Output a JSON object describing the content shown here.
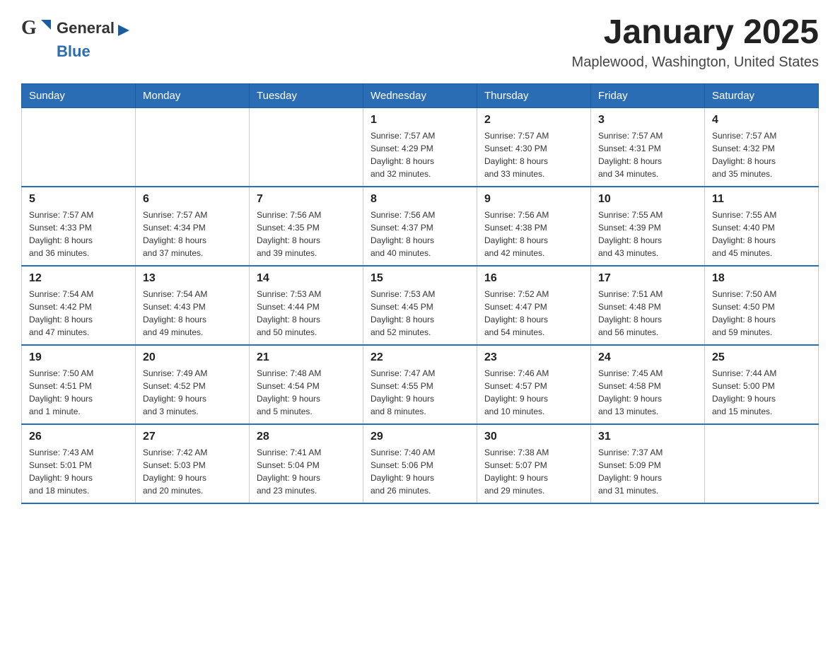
{
  "header": {
    "logo_general": "General",
    "logo_blue": "Blue",
    "title": "January 2025",
    "location": "Maplewood, Washington, United States"
  },
  "days_of_week": [
    "Sunday",
    "Monday",
    "Tuesday",
    "Wednesday",
    "Thursday",
    "Friday",
    "Saturday"
  ],
  "weeks": [
    {
      "days": [
        {
          "number": "",
          "info": ""
        },
        {
          "number": "",
          "info": ""
        },
        {
          "number": "",
          "info": ""
        },
        {
          "number": "1",
          "info": "Sunrise: 7:57 AM\nSunset: 4:29 PM\nDaylight: 8 hours\nand 32 minutes."
        },
        {
          "number": "2",
          "info": "Sunrise: 7:57 AM\nSunset: 4:30 PM\nDaylight: 8 hours\nand 33 minutes."
        },
        {
          "number": "3",
          "info": "Sunrise: 7:57 AM\nSunset: 4:31 PM\nDaylight: 8 hours\nand 34 minutes."
        },
        {
          "number": "4",
          "info": "Sunrise: 7:57 AM\nSunset: 4:32 PM\nDaylight: 8 hours\nand 35 minutes."
        }
      ]
    },
    {
      "days": [
        {
          "number": "5",
          "info": "Sunrise: 7:57 AM\nSunset: 4:33 PM\nDaylight: 8 hours\nand 36 minutes."
        },
        {
          "number": "6",
          "info": "Sunrise: 7:57 AM\nSunset: 4:34 PM\nDaylight: 8 hours\nand 37 minutes."
        },
        {
          "number": "7",
          "info": "Sunrise: 7:56 AM\nSunset: 4:35 PM\nDaylight: 8 hours\nand 39 minutes."
        },
        {
          "number": "8",
          "info": "Sunrise: 7:56 AM\nSunset: 4:37 PM\nDaylight: 8 hours\nand 40 minutes."
        },
        {
          "number": "9",
          "info": "Sunrise: 7:56 AM\nSunset: 4:38 PM\nDaylight: 8 hours\nand 42 minutes."
        },
        {
          "number": "10",
          "info": "Sunrise: 7:55 AM\nSunset: 4:39 PM\nDaylight: 8 hours\nand 43 minutes."
        },
        {
          "number": "11",
          "info": "Sunrise: 7:55 AM\nSunset: 4:40 PM\nDaylight: 8 hours\nand 45 minutes."
        }
      ]
    },
    {
      "days": [
        {
          "number": "12",
          "info": "Sunrise: 7:54 AM\nSunset: 4:42 PM\nDaylight: 8 hours\nand 47 minutes."
        },
        {
          "number": "13",
          "info": "Sunrise: 7:54 AM\nSunset: 4:43 PM\nDaylight: 8 hours\nand 49 minutes."
        },
        {
          "number": "14",
          "info": "Sunrise: 7:53 AM\nSunset: 4:44 PM\nDaylight: 8 hours\nand 50 minutes."
        },
        {
          "number": "15",
          "info": "Sunrise: 7:53 AM\nSunset: 4:45 PM\nDaylight: 8 hours\nand 52 minutes."
        },
        {
          "number": "16",
          "info": "Sunrise: 7:52 AM\nSunset: 4:47 PM\nDaylight: 8 hours\nand 54 minutes."
        },
        {
          "number": "17",
          "info": "Sunrise: 7:51 AM\nSunset: 4:48 PM\nDaylight: 8 hours\nand 56 minutes."
        },
        {
          "number": "18",
          "info": "Sunrise: 7:50 AM\nSunset: 4:50 PM\nDaylight: 8 hours\nand 59 minutes."
        }
      ]
    },
    {
      "days": [
        {
          "number": "19",
          "info": "Sunrise: 7:50 AM\nSunset: 4:51 PM\nDaylight: 9 hours\nand 1 minute."
        },
        {
          "number": "20",
          "info": "Sunrise: 7:49 AM\nSunset: 4:52 PM\nDaylight: 9 hours\nand 3 minutes."
        },
        {
          "number": "21",
          "info": "Sunrise: 7:48 AM\nSunset: 4:54 PM\nDaylight: 9 hours\nand 5 minutes."
        },
        {
          "number": "22",
          "info": "Sunrise: 7:47 AM\nSunset: 4:55 PM\nDaylight: 9 hours\nand 8 minutes."
        },
        {
          "number": "23",
          "info": "Sunrise: 7:46 AM\nSunset: 4:57 PM\nDaylight: 9 hours\nand 10 minutes."
        },
        {
          "number": "24",
          "info": "Sunrise: 7:45 AM\nSunset: 4:58 PM\nDaylight: 9 hours\nand 13 minutes."
        },
        {
          "number": "25",
          "info": "Sunrise: 7:44 AM\nSunset: 5:00 PM\nDaylight: 9 hours\nand 15 minutes."
        }
      ]
    },
    {
      "days": [
        {
          "number": "26",
          "info": "Sunrise: 7:43 AM\nSunset: 5:01 PM\nDaylight: 9 hours\nand 18 minutes."
        },
        {
          "number": "27",
          "info": "Sunrise: 7:42 AM\nSunset: 5:03 PM\nDaylight: 9 hours\nand 20 minutes."
        },
        {
          "number": "28",
          "info": "Sunrise: 7:41 AM\nSunset: 5:04 PM\nDaylight: 9 hours\nand 23 minutes."
        },
        {
          "number": "29",
          "info": "Sunrise: 7:40 AM\nSunset: 5:06 PM\nDaylight: 9 hours\nand 26 minutes."
        },
        {
          "number": "30",
          "info": "Sunrise: 7:38 AM\nSunset: 5:07 PM\nDaylight: 9 hours\nand 29 minutes."
        },
        {
          "number": "31",
          "info": "Sunrise: 7:37 AM\nSunset: 5:09 PM\nDaylight: 9 hours\nand 31 minutes."
        },
        {
          "number": "",
          "info": ""
        }
      ]
    }
  ]
}
